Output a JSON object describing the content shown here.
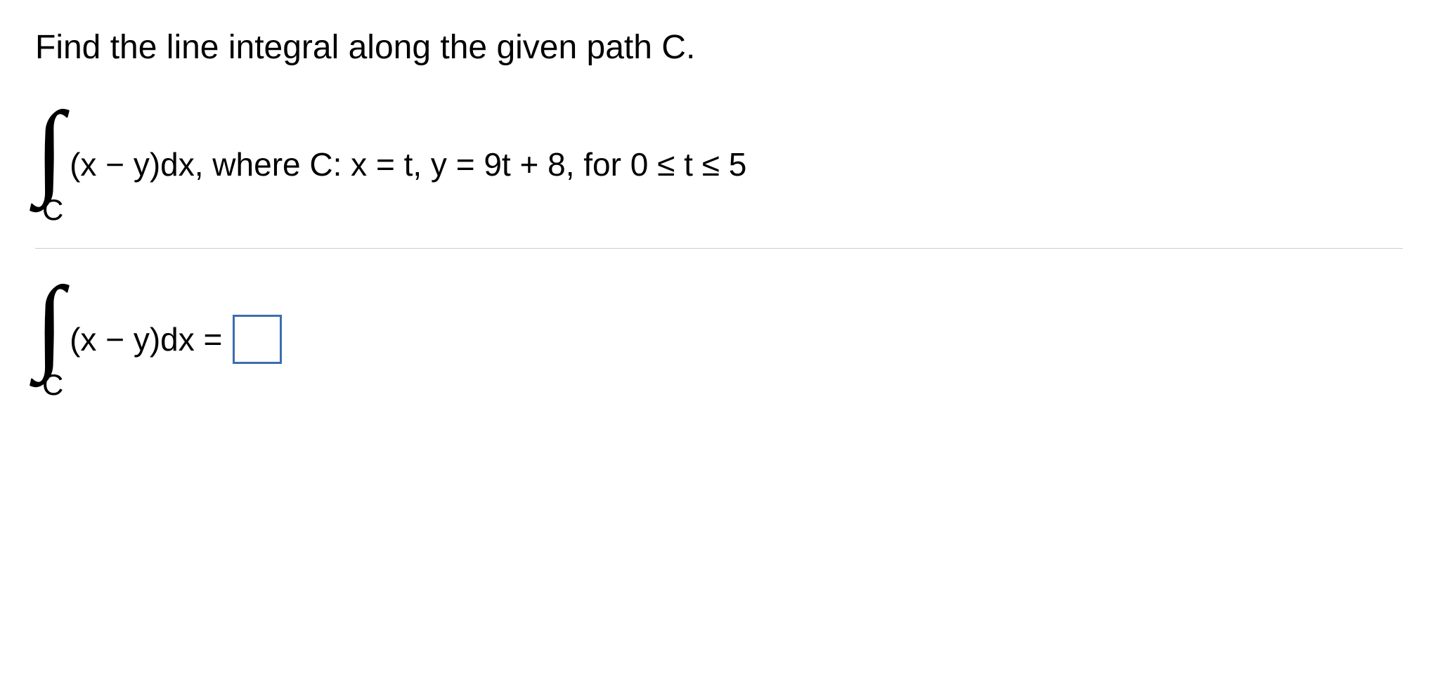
{
  "question": {
    "prompt": "Find the line integral along the given path C.",
    "integral_expr": "(x − y)dx",
    "integral_bound": "C",
    "where_text": ", where C: x = t, y = 9t + 8, for 0 ≤ t ≤ 5"
  },
  "answer": {
    "integral_expr": "(x − y)dx =",
    "integral_bound": "C",
    "value": ""
  }
}
